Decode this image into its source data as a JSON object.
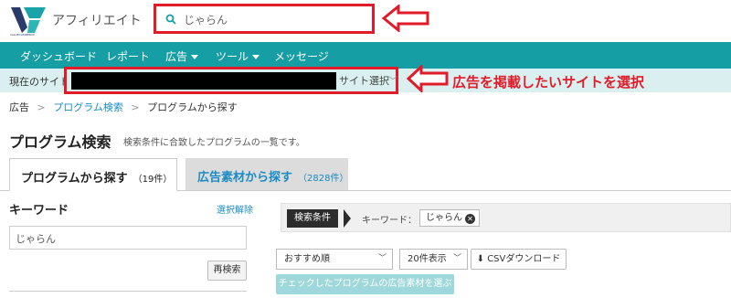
{
  "app": {
    "logo_title": "アフィリエイト",
    "logo_small_text": "VALUECOMMERCE"
  },
  "search": {
    "value": "じゃらん"
  },
  "nav": {
    "items": [
      {
        "label": "ダッシュボード"
      },
      {
        "label": "レポート"
      },
      {
        "label": "広告"
      },
      {
        "label": "ツール"
      },
      {
        "label": "メッセージ"
      }
    ]
  },
  "sitebar": {
    "label": "現在のサイト",
    "select_label": "サイト選択",
    "annotation": "広告を掲載したいサイトを選択"
  },
  "breadcrumb": {
    "items": [
      "広告",
      "プログラム検索",
      "プログラムから探す"
    ]
  },
  "page": {
    "title": "プログラム検索",
    "description": "検索条件に合致したプログラムの一覧です。"
  },
  "tabs": [
    {
      "label": "プログラムから探す",
      "count": "（19件）"
    },
    {
      "label": "広告素材から探す",
      "count": "（2828件）"
    }
  ],
  "keyword_panel": {
    "label": "キーワード",
    "clear": "選択解除",
    "value": "じゃらん",
    "search_again": "再検索"
  },
  "conditions": {
    "tag": "検索条件",
    "key": "キーワード：",
    "chip": "じゃらん"
  },
  "controls": {
    "sort": "おすすめ順",
    "per_page": "20件表示",
    "csv": "CSVダウンロード",
    "check_btn": "チェックしたプログラムの広告素材を選ぶ"
  },
  "colors": {
    "accent": "#159ea4",
    "highlight": "#e21b2a",
    "sitebar": "#d9eff0"
  }
}
